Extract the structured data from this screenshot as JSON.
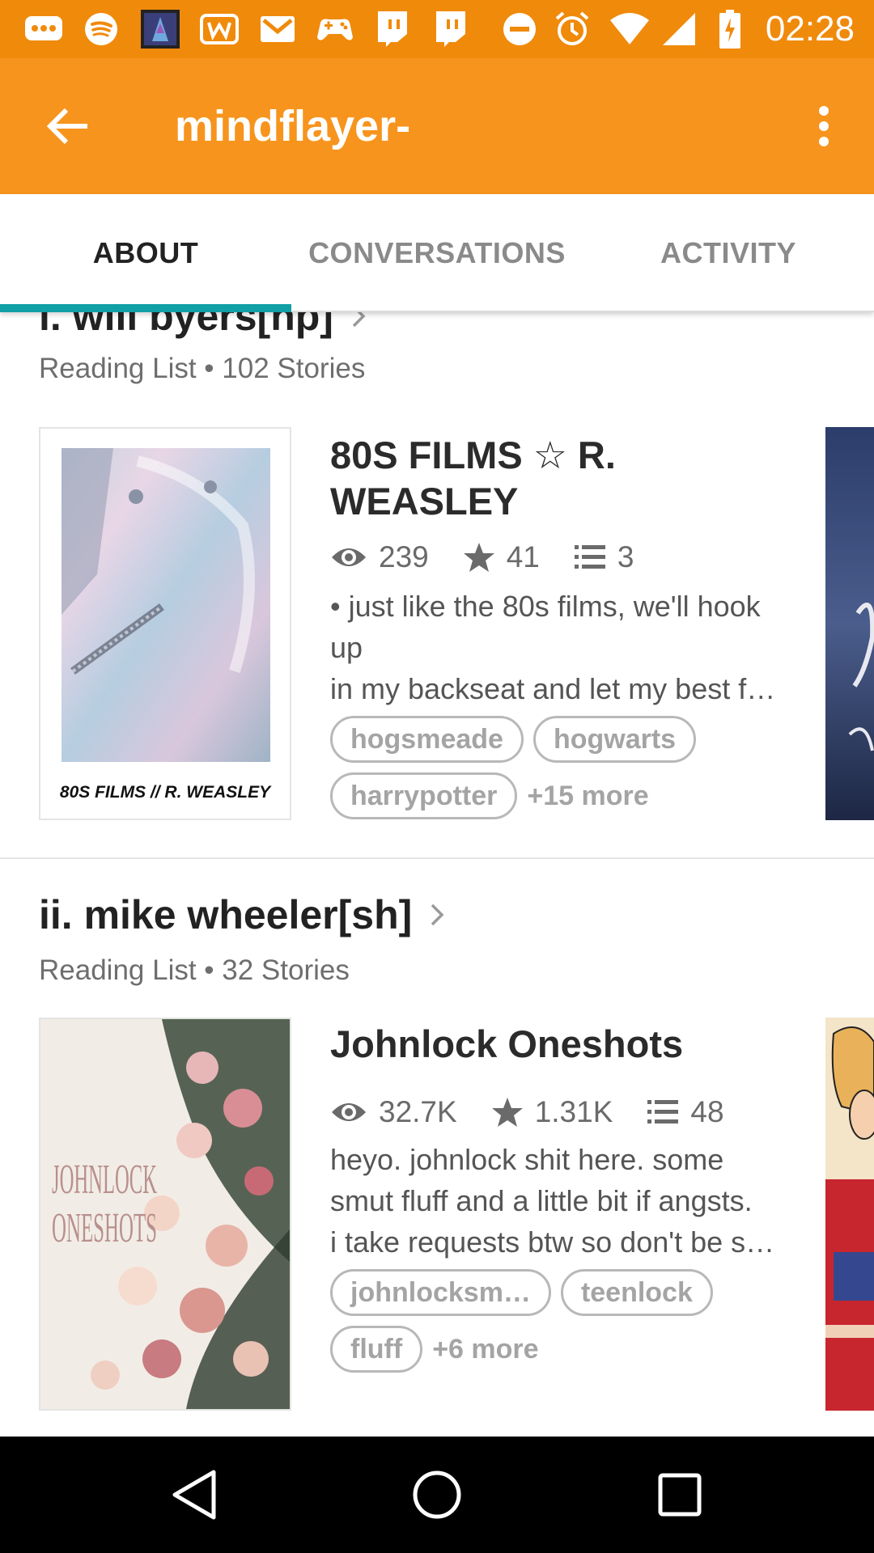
{
  "status_bar": {
    "time": "02:28",
    "icons": [
      "messages-icon",
      "spotify-icon",
      "app-thumbnail-icon",
      "wattpad-icon",
      "gmail-icon",
      "game-controller-icon",
      "twitch-icon",
      "twitch-icon",
      "do-not-disturb-icon",
      "alarm-icon",
      "wifi-icon",
      "signal-icon",
      "battery-charging-icon"
    ]
  },
  "app_bar": {
    "title": "mindflayer-",
    "back_icon": "arrow-back-icon",
    "menu_icon": "more-vert-icon",
    "color": "#f7941d"
  },
  "tabs": [
    {
      "label": "ABOUT",
      "active": true
    },
    {
      "label": "CONVERSATIONS",
      "active": false
    },
    {
      "label": "ACTIVITY",
      "active": false
    }
  ],
  "accent_color": "#11a0a6",
  "reading_lists": [
    {
      "title": "i. will byers[hp]",
      "subtitle": "Reading List • 102 Stories",
      "story": {
        "cover_caption": "80S FILMS // R. WEASLEY",
        "title_line1": "80S FILMS ☆ R.",
        "title_line2": "WEASLEY",
        "reads": "239",
        "votes": "41",
        "parts": "3",
        "desc_line1": "• just like the 80s films, we'll hook",
        "desc_line2": "up",
        "desc_line3": "in my backseat and let my best f…",
        "tags": [
          "hogsmeade",
          "hogwarts",
          "harrypotter"
        ],
        "more": "+15 more"
      }
    },
    {
      "title": "ii. mike wheeler[sh]",
      "subtitle": "Reading List • 32 Stories",
      "story": {
        "cover_caption_line1": "JOHNLOCK",
        "cover_caption_line2": "ONESHOTS",
        "title_line1": "Johnlock Oneshots",
        "reads": "32.7K",
        "votes": "1.31K",
        "parts": "48",
        "desc_line1": "heyo. johnlock shit here. some",
        "desc_line2": "smut fluff and a little bit if angsts.",
        "desc_line3": "i take requests btw so don't be s…",
        "tags": [
          "johnlocksm…",
          "teenlock",
          "fluff"
        ],
        "more": "+6 more"
      }
    }
  ],
  "nav_bar": {
    "icons": [
      "nav-back-icon",
      "nav-home-icon",
      "nav-recents-icon"
    ]
  }
}
